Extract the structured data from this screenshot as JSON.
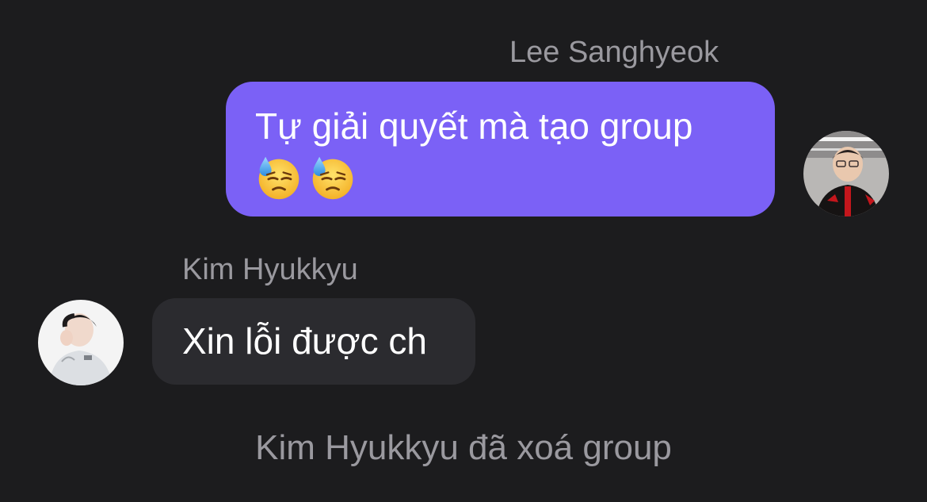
{
  "messages": {
    "outgoing": {
      "sender": "Lee Sanghyeok",
      "text": "Tự giải quyết mà tạo group",
      "emojis": [
        "downcast-face-with-sweat",
        "downcast-face-with-sweat"
      ],
      "bubble_color": "#7b61f6"
    },
    "incoming": {
      "sender": "Kim Hyukkyu",
      "text": "Xin lỗi được ch",
      "bubble_color": "#2b2b2f"
    }
  },
  "system": {
    "text": "Kim Hyukkyu đã xoá group"
  },
  "colors": {
    "background": "#1c1c1e",
    "secondary_text": "#9a999f"
  }
}
